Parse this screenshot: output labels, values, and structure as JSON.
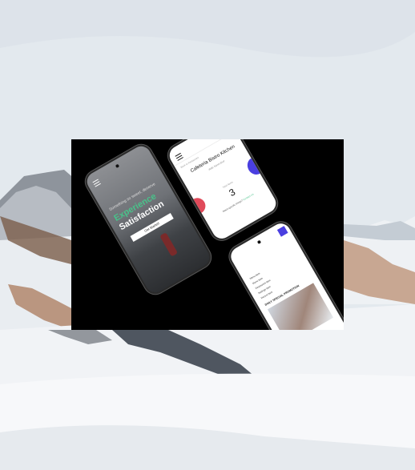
{
  "scene": {
    "description_colors": {
      "sky": "#e2e8ee",
      "snow": "#f2f4f6",
      "rock": "#6f5a4f",
      "accent_green": "#49c28a",
      "accent_blue": "#4a3fe0",
      "accent_red": "#e04a5a"
    }
  },
  "phone1": {
    "tagline": "Something so sweet, deserve",
    "headline_green": "Experience",
    "headline_white": "Satisfaction",
    "button_label": "Get Started"
  },
  "phone2": {
    "small_label": "Back to Restaurant",
    "restaurant_name": "Cafeteria Bistro Kitchen",
    "subtitle": "4935 Saints Blvd",
    "count_label": "Total Items",
    "count_value": "3",
    "link_text": "Need specific things?",
    "link_accent": "Contact Us"
  },
  "phone3": {
    "rows": [
      "Menu Item",
      "Menu Item",
      "Restaurant Item",
      "Settings Item",
      "Recent Item"
    ],
    "section_title": "DAILY SPECIAL PROMOTION"
  }
}
